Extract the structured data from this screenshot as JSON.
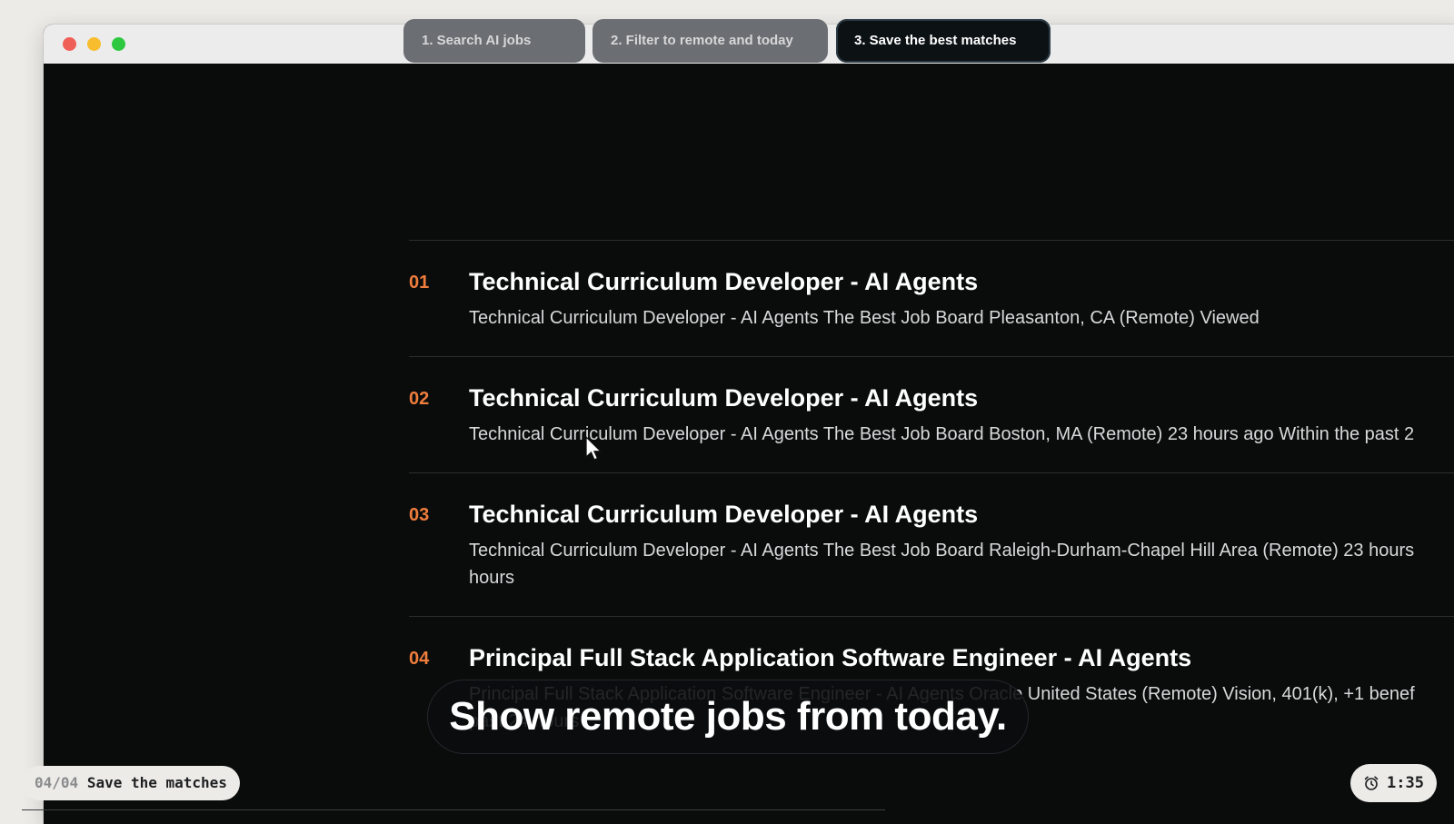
{
  "steps": [
    {
      "label": "1. Search AI jobs",
      "active": false
    },
    {
      "label": "2. Filter to remote and today",
      "active": false
    },
    {
      "label": "3. Save the best matches",
      "active": true
    }
  ],
  "results": [
    {
      "number": "01",
      "title": "Technical Curriculum Developer - AI Agents",
      "description": "Technical Curriculum Developer - AI Agents The Best Job Board Pleasanton, CA (Remote) Viewed"
    },
    {
      "number": "02",
      "title": "Technical Curriculum Developer - AI Agents",
      "description": "Technical Curriculum Developer - AI Agents The Best Job Board Boston, MA (Remote) 23 hours ago Within the past 2"
    },
    {
      "number": "03",
      "title": "Technical Curriculum Developer - AI Agents",
      "description": "Technical Curriculum Developer - AI Agents The Best Job Board Raleigh-Durham-Chapel Hill Area (Remote) 23 hours",
      "description_line2": "hours"
    },
    {
      "number": "04",
      "title": "Principal Full Stack Application Software Engineer - AI Agents",
      "description": "Principal Full Stack Application Software Engineer - AI Agents Oracle United States (Remote) Vision, 401(k), +1 benef",
      "description_line2": "past 24 hours"
    }
  ],
  "caption": "Show remote jobs from today.",
  "step_indicator": {
    "count": "04/04",
    "label": "Save the matches"
  },
  "timer": {
    "icon": "alarm-clock-icon",
    "value": "1:35"
  },
  "colors": {
    "accent_number": "#ef7d3c",
    "window_bg": "#0a0c0c"
  }
}
